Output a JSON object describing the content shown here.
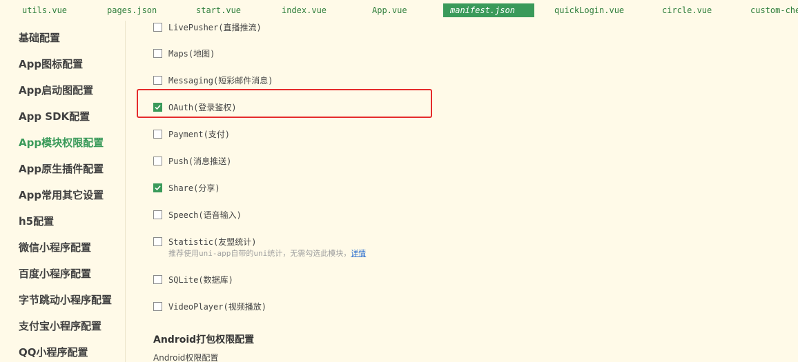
{
  "tabs": [
    {
      "label": "utils.vue",
      "active": false
    },
    {
      "label": "pages.json",
      "active": false
    },
    {
      "label": "start.vue",
      "active": false
    },
    {
      "label": "index.vue",
      "active": false
    },
    {
      "label": "App.vue",
      "active": false
    },
    {
      "label": "manifest.json",
      "active": true
    },
    {
      "label": "quickLogin.vue",
      "active": false
    },
    {
      "label": "circle.vue",
      "active": false
    },
    {
      "label": "custom-che",
      "active": false
    }
  ],
  "sidebar": {
    "items": [
      {
        "label": "基础配置",
        "active": false
      },
      {
        "label": "App图标配置",
        "active": false
      },
      {
        "label": "App启动图配置",
        "active": false
      },
      {
        "label": "App SDK配置",
        "active": false
      },
      {
        "label": "App模块权限配置",
        "active": true
      },
      {
        "label": "App原生插件配置",
        "active": false
      },
      {
        "label": "App常用其它设置",
        "active": false
      },
      {
        "label": "h5配置",
        "active": false
      },
      {
        "label": "微信小程序配置",
        "active": false
      },
      {
        "label": "百度小程序配置",
        "active": false
      },
      {
        "label": "字节跳动小程序配置",
        "active": false
      },
      {
        "label": "支付宝小程序配置",
        "active": false
      },
      {
        "label": "QQ小程序配置",
        "active": false
      }
    ]
  },
  "modules": [
    {
      "label": "LivePusher(直播推流)",
      "checked": false
    },
    {
      "label": "Maps(地图)",
      "checked": false
    },
    {
      "label": "Messaging(短彩邮件消息)",
      "checked": false
    },
    {
      "label": "OAuth(登录鉴权)",
      "checked": true
    },
    {
      "label": "Payment(支付)",
      "checked": false
    },
    {
      "label": "Push(消息推送)",
      "checked": false
    },
    {
      "label": "Share(分享)",
      "checked": true
    },
    {
      "label": "Speech(语音输入)",
      "checked": false
    },
    {
      "label": "Statistic(友盟统计)",
      "checked": false
    },
    {
      "label": "SQLite(数据库)",
      "checked": false
    },
    {
      "label": "VideoPlayer(视频播放)",
      "checked": false
    }
  ],
  "statistic_hint": {
    "text": "推荐使用uni-app自带的uni统计，无需勾选此模块，",
    "link": "详情"
  },
  "android_section": {
    "title": "Android打包权限配置",
    "subtitle": "Android权限配置"
  },
  "colors": {
    "background": "#fffae8",
    "accent_green": "#3a9a5a",
    "highlight_red": "#e52b2b",
    "link_blue": "#2a6ecf"
  }
}
